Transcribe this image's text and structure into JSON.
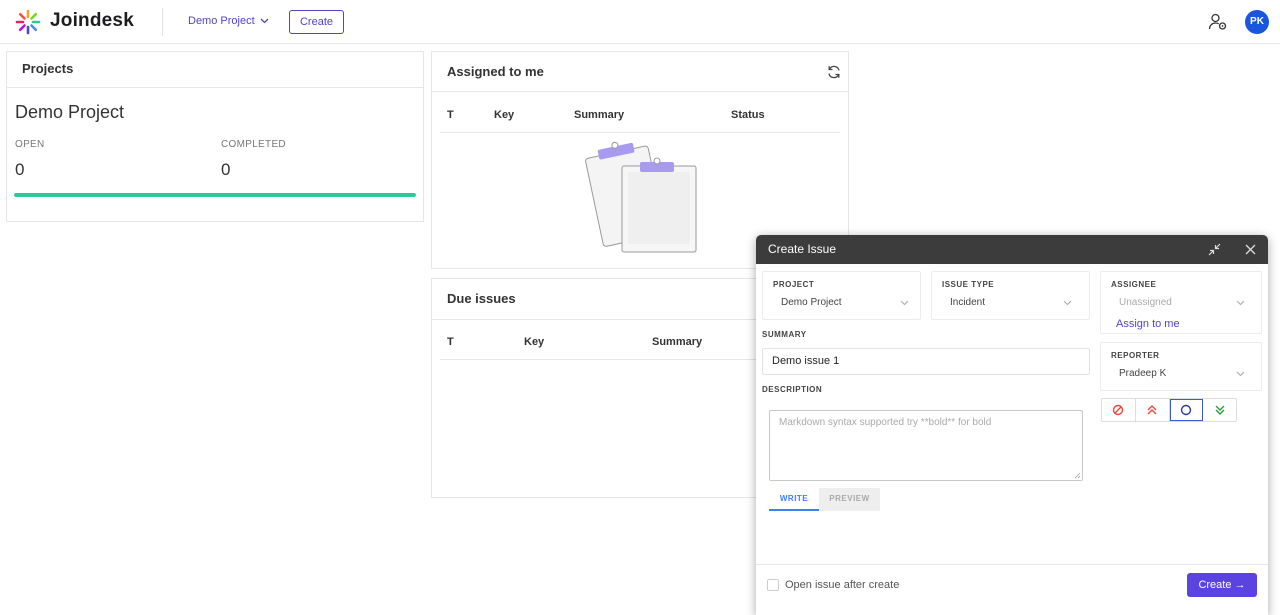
{
  "header": {
    "logo_text": "Joindesk",
    "project_switch": "Demo Project",
    "create_label": "Create",
    "avatar_initials": "PK"
  },
  "projects_card": {
    "title": "Projects",
    "project_name": "Demo Project",
    "open_label": "OPEN",
    "open_value": "0",
    "completed_label": "COMPLETED",
    "completed_value": "0",
    "progress_fraction": 1.0
  },
  "assigned_card": {
    "title": "Assigned to me",
    "columns": [
      "T",
      "Key",
      "Summary",
      "Status"
    ]
  },
  "due_card": {
    "title": "Due issues",
    "columns": [
      "T",
      "Key",
      "Summary"
    ]
  },
  "modal": {
    "title": "Create Issue",
    "project": {
      "label": "PROJECT",
      "value": "Demo Project"
    },
    "issue_type": {
      "label": "ISSUE TYPE",
      "value": "Incident"
    },
    "assignee": {
      "label": "ASSIGNEE",
      "value": "Unassigned",
      "assign_link": "Assign to me"
    },
    "reporter": {
      "label": "REPORTER",
      "value": "Pradeep K"
    },
    "summary": {
      "label": "SUMMARY",
      "value": "Demo issue 1"
    },
    "description": {
      "label": "DESCRIPTION",
      "placeholder": "Markdown syntax supported try **bold** for bold"
    },
    "tabs": {
      "write": "WRITE",
      "preview": "PREVIEW"
    },
    "priority_icons": [
      "blocker-icon",
      "high-priority-icon",
      "medium-priority-icon",
      "low-priority-icon"
    ],
    "open_after_create": "Open issue after create",
    "create_label": "Create →"
  },
  "colors": {
    "brand": "#5046c8",
    "progress": "#2ec99a",
    "avatar": "#1a56db",
    "primary_button": "#5a43e0"
  }
}
